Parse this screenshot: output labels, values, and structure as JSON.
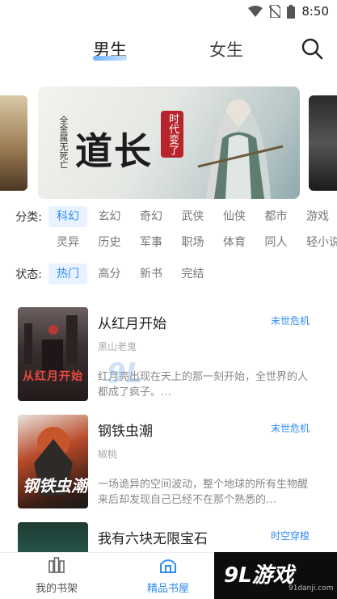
{
  "status_bar": {
    "time": "8:50"
  },
  "top_tabs": [
    {
      "label": "男生",
      "active": true
    },
    {
      "label": "女生",
      "active": false
    }
  ],
  "banner": {
    "title": "道长",
    "stamp": "时代变了",
    "subtitle": "全金属无死亡"
  },
  "filters": {
    "category_label": "分类:",
    "categories_row1": [
      "科幻",
      "玄幻",
      "奇幻",
      "武侠",
      "仙侠",
      "都市",
      "游戏"
    ],
    "categories_row2": [
      "灵异",
      "历史",
      "军事",
      "职场",
      "体育",
      "同人",
      "轻小说"
    ],
    "active_category": "科幻",
    "status_label": "状态:",
    "statuses": [
      "热门",
      "高分",
      "新书",
      "完结"
    ],
    "active_status": "热门"
  },
  "books": [
    {
      "title": "从红月开始",
      "tag": "末世危机",
      "author": "黑山老鬼",
      "description": "红月亮出现在天上的那一刻开始，全世界的人都成了疯子。…",
      "cover_text": "从红月开始"
    },
    {
      "title": "钢铁虫潮",
      "tag": "末世危机",
      "author": "椒桃",
      "description": "一场诡异的空间波动，整个地球的所有生物醒来后却发现自己已经不在那个熟悉的…",
      "cover_text": "钢铁虫潮"
    },
    {
      "title": "我有六块无限宝石",
      "tag": "时空穿梭",
      "author": "",
      "description": "",
      "cover_text": ""
    }
  ],
  "bottom_nav": [
    {
      "label": "我的书架",
      "icon": "bookshelf-icon",
      "active": false
    },
    {
      "label": "精品书屋",
      "icon": "house-icon",
      "active": true
    }
  ],
  "watermark": {
    "logo": "9L游戏",
    "url": "91danji.com",
    "mid": "9L"
  },
  "colors": {
    "accent": "#2f8df2",
    "active_chip_bg": "#e9f2ff"
  }
}
